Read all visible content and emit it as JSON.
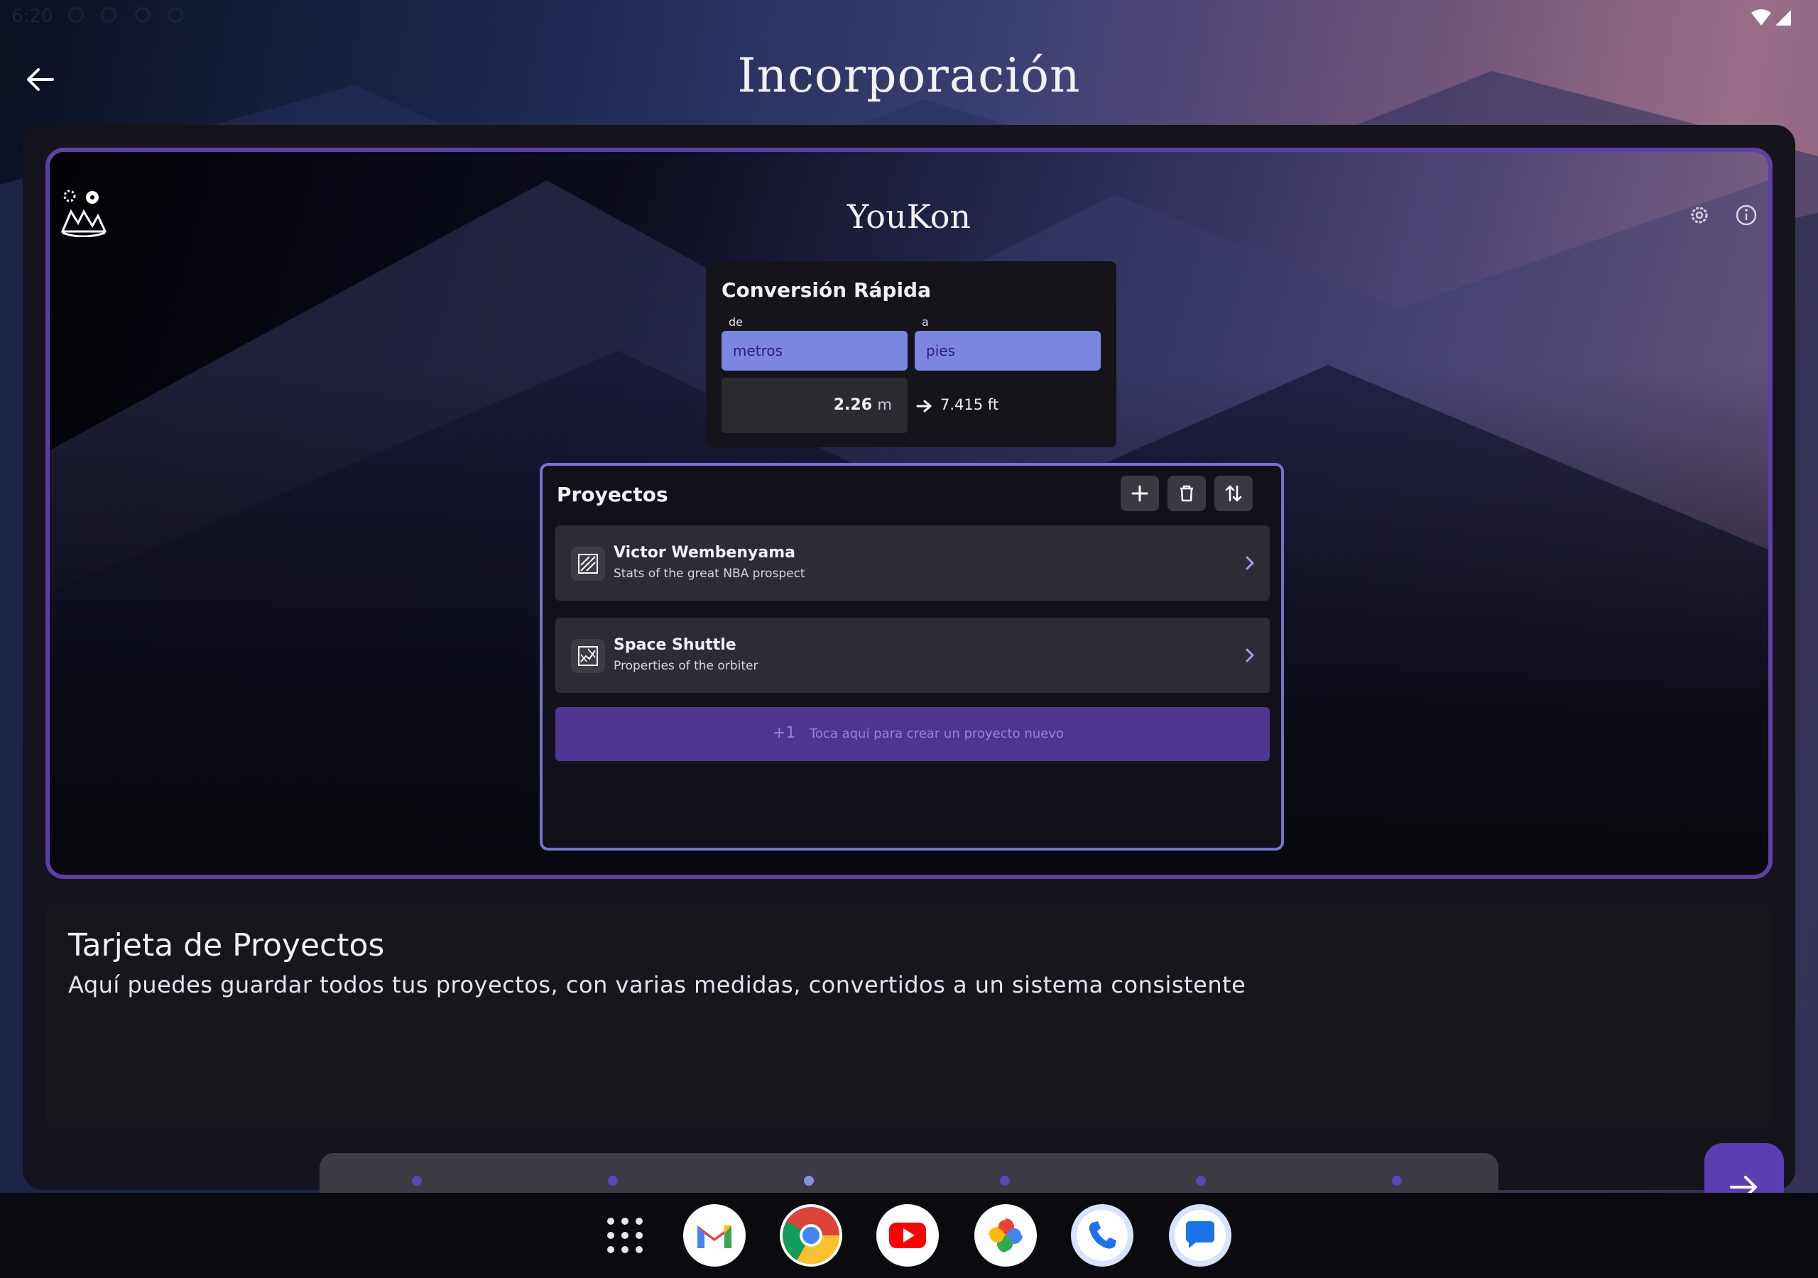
{
  "status_bar": {
    "time": "6:20"
  },
  "header": {
    "title": "Incorporación",
    "back_icon": "arrow-left-icon"
  },
  "app_preview": {
    "app_name": "YouKon",
    "logo_icon": "youkon-logo-icon",
    "settings_icon": "gear-icon",
    "info_icon": "info-icon",
    "quick_conversion": {
      "title": "Conversión Rápida",
      "from_label": "de",
      "to_label": "a",
      "from_unit": "metros",
      "to_unit": "pies",
      "input_value": "2.26",
      "input_unit": "m",
      "result": "7.415 ft"
    },
    "projects": {
      "title": "Proyectos",
      "actions": [
        "plus-icon",
        "trash-icon",
        "sort-icon"
      ],
      "items": [
        {
          "name": "Victor Wembenyama",
          "description": "Stats of the great NBA prospect"
        },
        {
          "name": "Space Shuttle",
          "description": "Properties of the orbiter"
        }
      ],
      "create": {
        "plus": "+1",
        "label": "Toca aquí para crear un proyecto nuevo"
      }
    }
  },
  "description": {
    "title": "Tarjeta de Proyectos",
    "text": "Aquí puedes guardar todos tus proyectos, con varias medidas, convertidos a un sistema consistente"
  },
  "pager": {
    "total_pages": 6,
    "current_page": 3
  },
  "dock": {
    "apps": [
      "gmail",
      "chrome",
      "youtube",
      "photos",
      "phone",
      "messages"
    ]
  },
  "colors": {
    "accent": "#5e3fa7",
    "select_bg": "#7b86e0",
    "create_bg": "#4e3591",
    "border_light": "#7672cf"
  }
}
